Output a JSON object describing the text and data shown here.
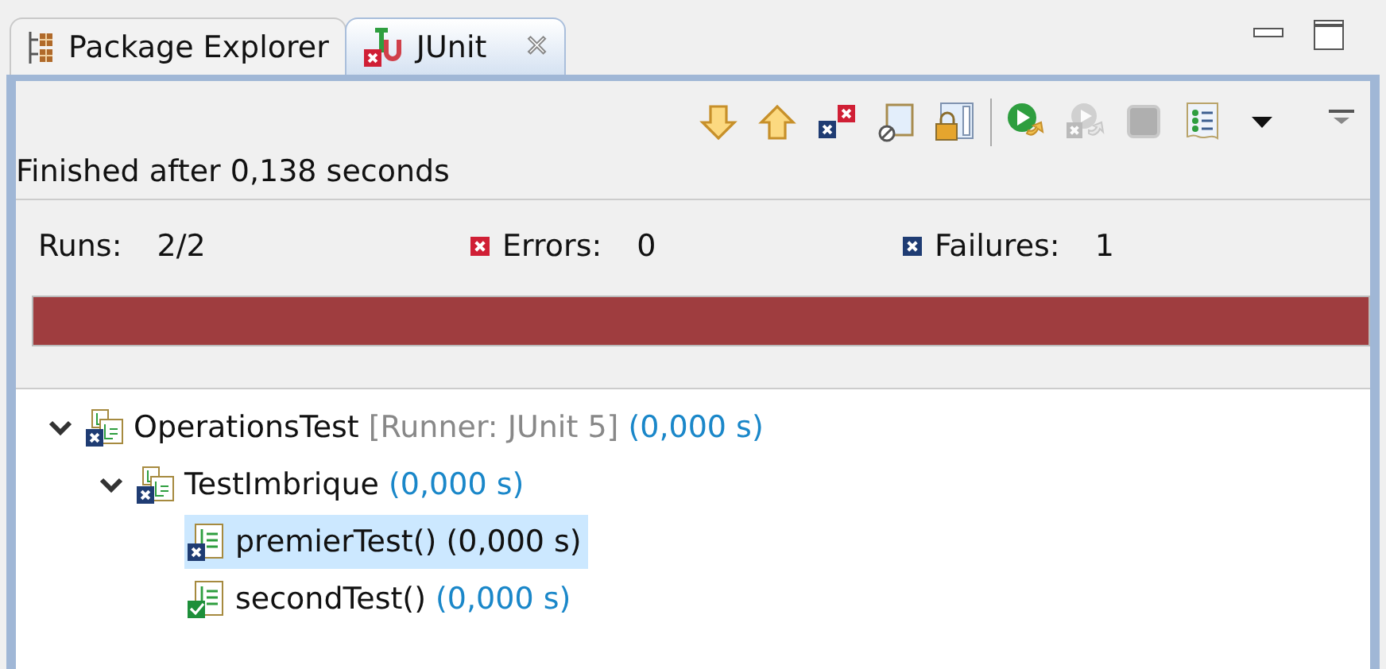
{
  "tabs": [
    {
      "label": "Package Explorer",
      "kind": "explorer",
      "selected": false
    },
    {
      "label": "JUnit",
      "kind": "junit",
      "selected": true,
      "close": "✕"
    }
  ],
  "toolbar": [
    {
      "kind": "next-failure",
      "disabled": false
    },
    {
      "kind": "prev-failure",
      "disabled": false
    },
    {
      "kind": "failures-only",
      "disabled": false
    },
    {
      "kind": "skipped",
      "disabled": false
    },
    {
      "kind": "scroll-lock",
      "disabled": false
    },
    {
      "kind": "rerun",
      "disabled": false
    },
    {
      "kind": "rerun-failed",
      "disabled": true
    },
    {
      "kind": "stop",
      "disabled": true
    },
    {
      "kind": "history",
      "disabled": false
    },
    {
      "kind": "menu",
      "disabled": false
    }
  ],
  "status": "Finished after 0,138 seconds",
  "counters": [
    {
      "label": "Runs:",
      "value": "2/2",
      "kind": "runs"
    },
    {
      "label": "Errors:",
      "value": "0",
      "kind": "errors"
    },
    {
      "label": "Failures:",
      "value": "1",
      "kind": "failures"
    }
  ],
  "progress": {
    "level": 1,
    "failed": true
  },
  "tree": [
    {
      "name": "OperationsTest",
      "detail": "[Runner: JUnit 5]",
      "time": "(0,000 s)",
      "kind": "suite",
      "failed": true,
      "expanded": true,
      "selected": false,
      "children": [
        {
          "name": "TestImbrique",
          "time": "(0,000 s)",
          "kind": "suite",
          "failed": true,
          "expanded": true,
          "selected": false,
          "children": [
            {
              "name": "premierTest()",
              "time": "(0,000 s)",
              "kind": "test",
              "failed": true,
              "selected": true
            },
            {
              "name": "secondTest()",
              "time": "(0,000 s)",
              "kind": "test",
              "failed": false,
              "selected": false
            }
          ]
        }
      ]
    }
  ]
}
